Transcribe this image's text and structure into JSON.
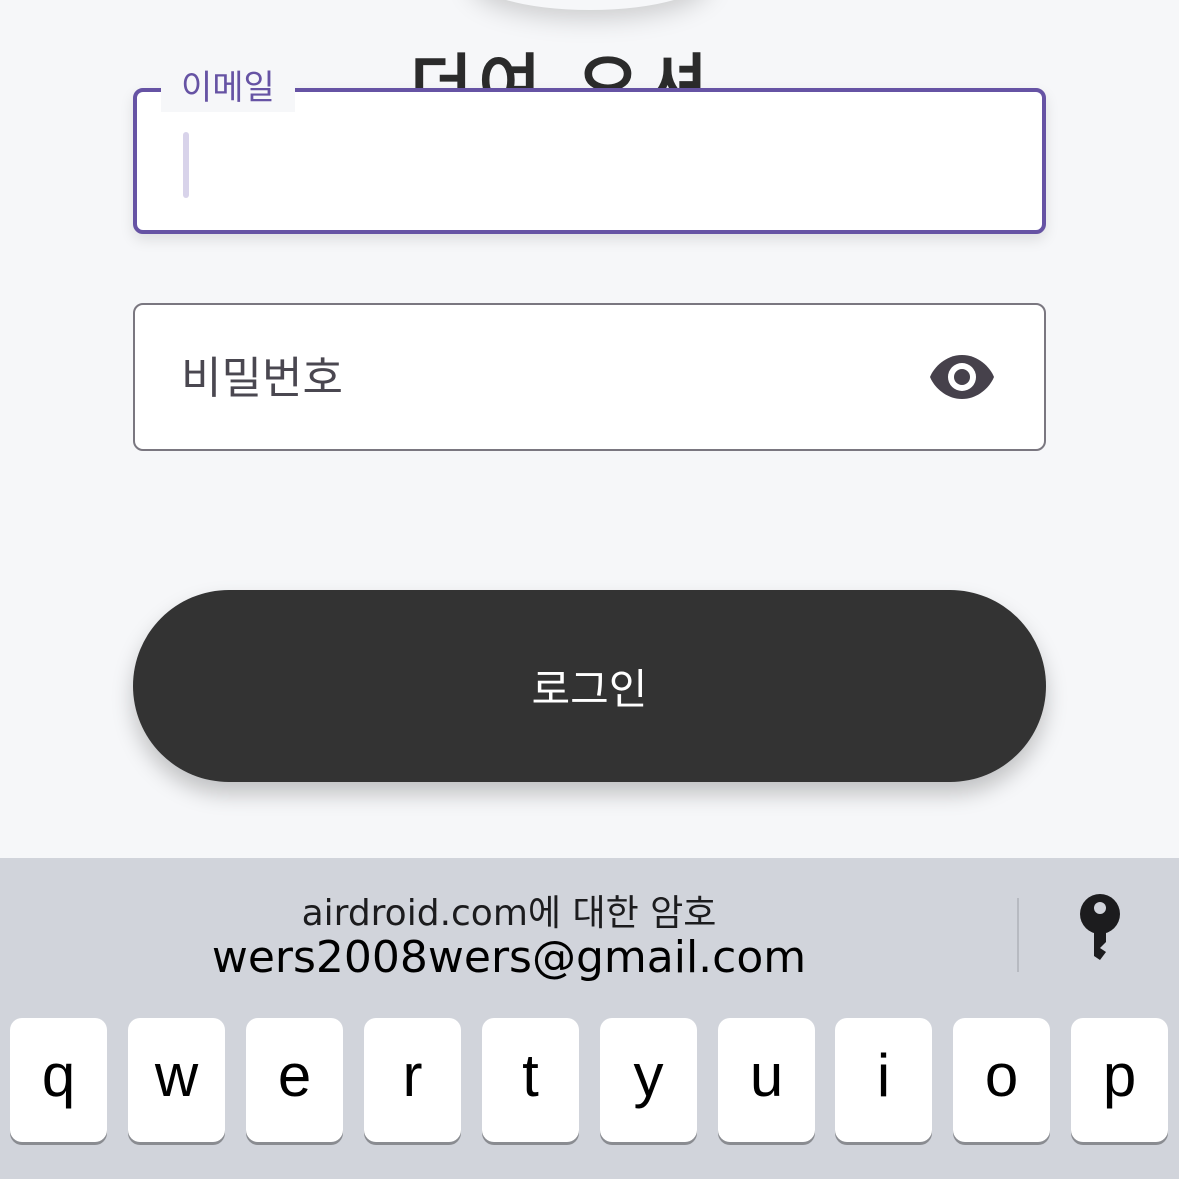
{
  "app": {
    "title": "더여 오셔"
  },
  "email": {
    "label": "이메일",
    "value": ""
  },
  "password": {
    "placeholder": "비밀번호",
    "toggle_icon": "eye-icon"
  },
  "login": {
    "label": "로그인"
  },
  "keyboard": {
    "suggestion_title": "airdroid.com에 대한 암호",
    "suggestion_account": "wers2008wers@gmail.com",
    "password_icon": "key-icon",
    "row1": [
      "q",
      "w",
      "e",
      "r",
      "t",
      "y",
      "u",
      "i",
      "o",
      "p"
    ]
  },
  "colors": {
    "accent": "#6653a4",
    "button": "#333333",
    "background": "#f6f7f9",
    "keyboard": "#d1d4db"
  }
}
